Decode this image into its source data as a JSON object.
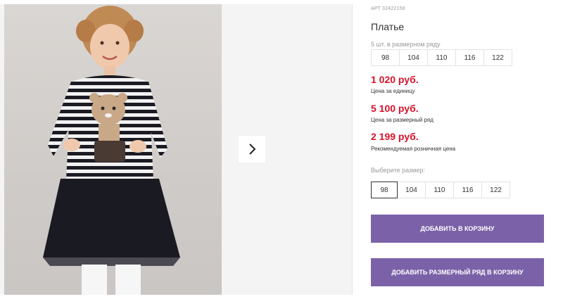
{
  "product": {
    "art": "АРТ 32422158",
    "title": "Платье",
    "pack_label": "5 шт. в размерном ряду",
    "pack_sizes": [
      "98",
      "104",
      "110",
      "116",
      "122"
    ],
    "prices": [
      {
        "value": "1 020 руб.",
        "caption": "Цена за единицу"
      },
      {
        "value": "5 100 руб.",
        "caption": "Цена за размерный ряд"
      },
      {
        "value": "2 199 руб.",
        "caption": "Рекомендуемая розничная цена"
      }
    ],
    "choose_label": "Выберите размер:",
    "sizes": [
      "98",
      "104",
      "110",
      "116",
      "122"
    ],
    "selected_size": "98"
  },
  "gallery": {
    "next_icon": "chevron-right-icon"
  },
  "buttons": {
    "add_to_cart": "ДОБАВИТЬ В КОРЗИНУ",
    "add_row_to_cart": "ДОБАВИТЬ РАЗМЕРНЫЙ РЯД В КОРЗИНУ"
  },
  "colors": {
    "price": "#d6122a",
    "button": "#7b62a8"
  }
}
